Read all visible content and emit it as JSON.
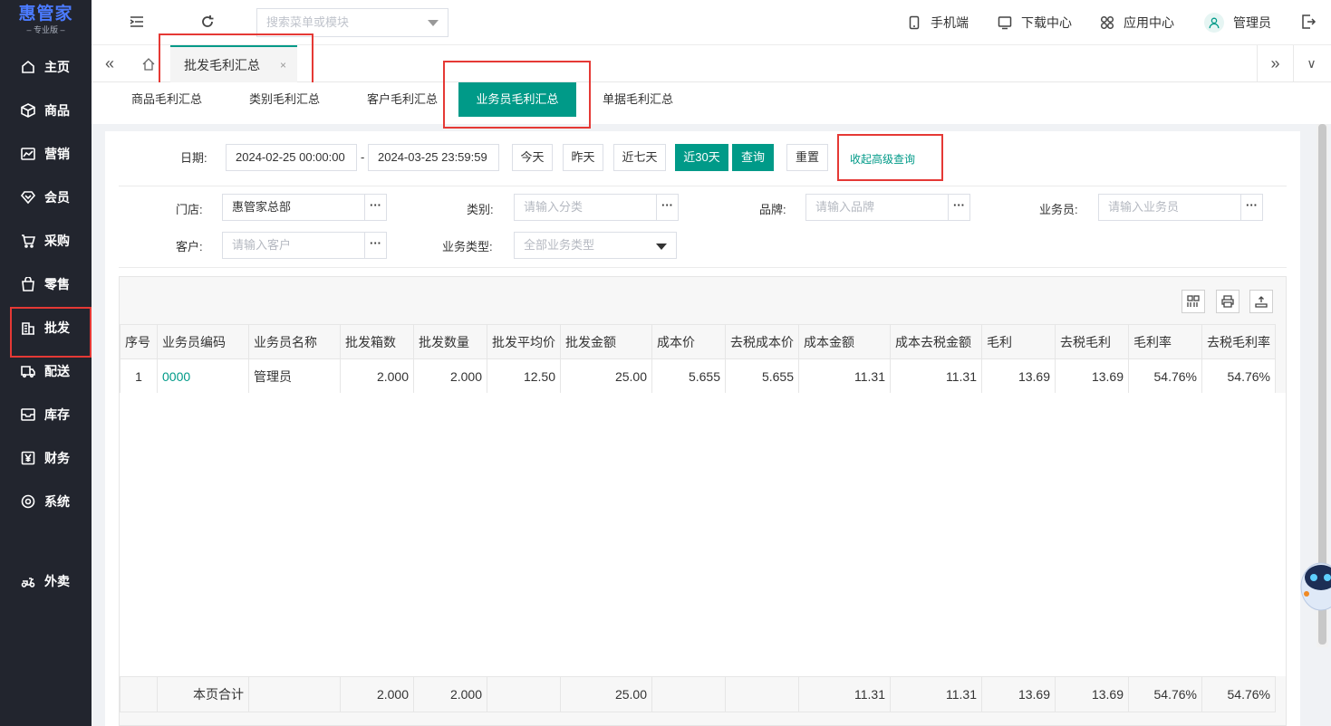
{
  "brand": {
    "name": "惠管家",
    "edition": "专业版",
    "color": "#4b7bff"
  },
  "sidebar": {
    "items": [
      {
        "label": "主页",
        "icon": "home-icon"
      },
      {
        "label": "商品",
        "icon": "box-icon"
      },
      {
        "label": "营销",
        "icon": "chart-icon"
      },
      {
        "label": "会员",
        "icon": "diamond-icon"
      },
      {
        "label": "采购",
        "icon": "cart-icon"
      },
      {
        "label": "零售",
        "icon": "bag-icon"
      },
      {
        "label": "批发",
        "icon": "building-icon"
      },
      {
        "label": "配送",
        "icon": "truck-icon"
      },
      {
        "label": "库存",
        "icon": "inbox-icon"
      },
      {
        "label": "财务",
        "icon": "yen-icon"
      },
      {
        "label": "系统",
        "icon": "target-icon"
      },
      {
        "label": "外卖",
        "icon": "scooter-icon"
      }
    ]
  },
  "topbar": {
    "search_placeholder": "搜索菜单或模块",
    "mobile": "手机端",
    "download": "下载中心",
    "apps": "应用中心",
    "user": "管理员"
  },
  "tabs": {
    "active": "批发毛利汇总",
    "close": "×"
  },
  "subtabs": [
    "商品毛利汇总",
    "类别毛利汇总",
    "客户毛利汇总",
    "业务员毛利汇总",
    "单据毛利汇总"
  ],
  "filters": {
    "date_label": "日期:",
    "date_start": "2024-02-25 00:00:00",
    "date_sep": "-",
    "date_end": "2024-03-25 23:59:59",
    "btn_today": "今天",
    "btn_yesterday": "昨天",
    "btn_7days": "近七天",
    "btn_30days": "近30天",
    "btn_query": "查询",
    "btn_reset": "重置",
    "collapse_link": "收起高级查询",
    "store_label": "门店:",
    "store_value": "惠管家总部",
    "category_label": "类别:",
    "category_ph": "请输入分类",
    "brand_label": "品牌:",
    "brand_ph": "请输入品牌",
    "salesman_label": "业务员:",
    "salesman_ph": "请输入业务员",
    "customer_label": "客户:",
    "customer_ph": "请输入客户",
    "biztype_label": "业务类型:",
    "biztype_value": "全部业务类型",
    "dots": "···"
  },
  "table": {
    "columns": [
      "序号",
      "业务员编码",
      "业务员名称",
      "批发箱数",
      "批发数量",
      "批发平均价",
      "批发金额",
      "成本价",
      "去税成本价",
      "成本金额",
      "成本去税金额",
      "毛利",
      "去税毛利",
      "毛利率",
      "去税毛利率"
    ],
    "row": [
      "1",
      "0000",
      "管理员",
      "2.000",
      "2.000",
      "12.50",
      "25.00",
      "5.655",
      "5.655",
      "11.31",
      "11.31",
      "13.69",
      "13.69",
      "54.76%",
      "54.76%"
    ],
    "sum_label": "本页合计",
    "sum": [
      "",
      "",
      "2.000",
      "2.000",
      "",
      "25.00",
      "",
      "",
      "11.31",
      "11.31",
      "13.69",
      "13.69",
      "54.76%",
      "54.76%"
    ]
  },
  "accent": "#009a88",
  "highlight": "#e53935"
}
